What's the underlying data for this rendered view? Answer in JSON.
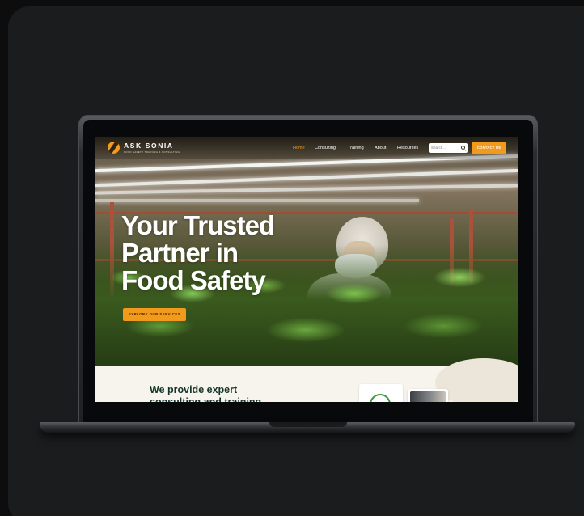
{
  "site": {
    "logo_text": "ASK SONIA",
    "logo_tagline": "FOOD SAFETY TRAINING & CONSULTING"
  },
  "nav": {
    "items": [
      {
        "label": "Home",
        "active": true
      },
      {
        "label": "Consulting",
        "active": false
      },
      {
        "label": "Training",
        "active": false
      },
      {
        "label": "About",
        "active": false
      },
      {
        "label": "Resources",
        "active": false
      }
    ],
    "search_placeholder": "Search...",
    "contact_label": "CONTACT US"
  },
  "hero": {
    "title_lines": [
      "Your Trusted",
      "Partner in",
      "Food Safety"
    ],
    "cta_label": "EXPLORE OUR SERVICES"
  },
  "section": {
    "title": "We provide expert consulting and training"
  },
  "colors": {
    "accent": "#f29a1c",
    "heading_dark": "#15352a",
    "section_bg": "#f7f4ee"
  },
  "icons": [
    "logo-leaf-icon",
    "search-icon"
  ]
}
